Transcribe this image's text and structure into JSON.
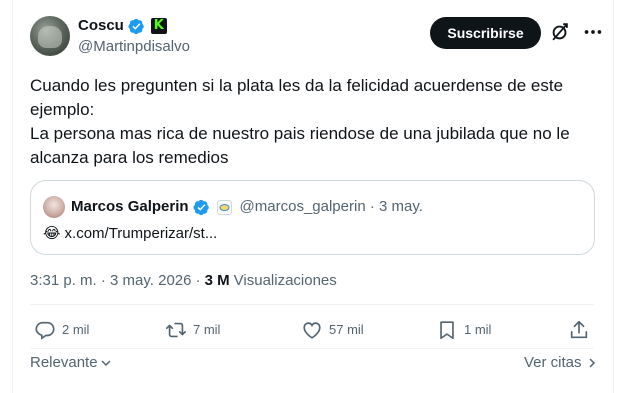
{
  "author": {
    "display_name": "Coscu",
    "handle": "@Martinpdisalvo",
    "badge_letter": "K"
  },
  "header": {
    "subscribe_label": "Suscribirse"
  },
  "tweet": {
    "text": "Cuando les pregunten si la plata les da la felicidad acuerdense de este\nejemplo:\nLa persona mas rica de nuestro pais riendose de una jubilada que no le\nalcanza para los remedios"
  },
  "quote": {
    "display_name": "Marcos Galperin",
    "handle_date": "@marcos_galperin · 3 may.",
    "emoji": "😂",
    "link_text": "x.com/Trumperizar/st..."
  },
  "meta": {
    "timestamp": "3:31 p. m. · 3 may. 2026 ·",
    "views_count": "3 M",
    "views_label": "Visualizaciones"
  },
  "actions": {
    "replies": "2 mil",
    "reposts": "7 mil",
    "likes": "57 mil",
    "bookmarks": "1 mil"
  },
  "footer": {
    "sort_label": "Relevante",
    "quotes_label": "Ver citas"
  },
  "colors": {
    "verified_blue": "#1d9bf0",
    "text_primary": "#0f1419",
    "text_secondary": "#536471",
    "kick_green": "#53fc18"
  },
  "icons": [
    "verified-icon",
    "kick-badge-icon",
    "grok-icon",
    "more-icon",
    "reply-icon",
    "repost-icon",
    "like-icon",
    "bookmark-icon",
    "share-icon",
    "chevron-down-icon",
    "chevron-right-icon"
  ]
}
